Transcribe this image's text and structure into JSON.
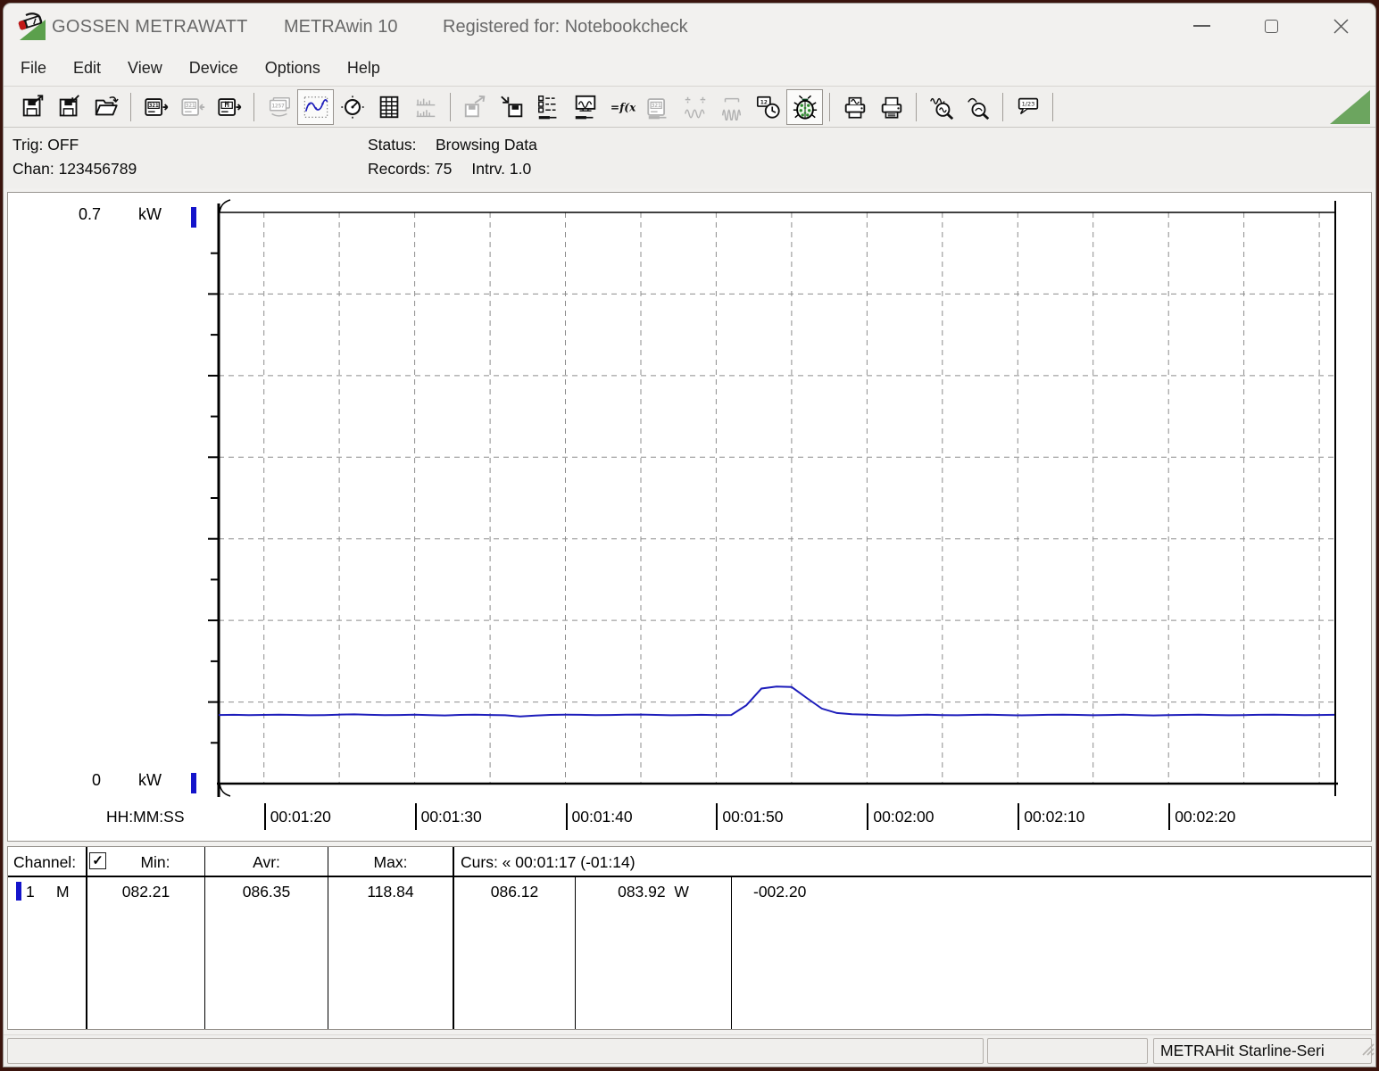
{
  "titlebar": {
    "brand": "GOSSEN METRAWATT",
    "app": "METRAwin 10",
    "registered": "Registered for: Notebookcheck"
  },
  "menu": {
    "items": [
      "File",
      "Edit",
      "View",
      "Device",
      "Options",
      "Help"
    ]
  },
  "toolbar": {
    "groups": [
      [
        {
          "name": "file-save-export",
          "state": "normal"
        },
        {
          "name": "file-save-import",
          "state": "normal"
        },
        {
          "name": "file-open",
          "state": "normal"
        }
      ],
      [
        {
          "name": "device-read",
          "state": "normal"
        },
        {
          "name": "device-send",
          "state": "disabled"
        },
        {
          "name": "memory-read",
          "state": "normal"
        }
      ],
      [
        {
          "name": "multi-display",
          "state": "disabled"
        },
        {
          "name": "line-chart-view",
          "state": "active"
        },
        {
          "name": "analog-view",
          "state": "normal"
        },
        {
          "name": "table-view",
          "state": "normal"
        },
        {
          "name": "histogram-view",
          "state": "disabled"
        }
      ],
      [
        {
          "name": "data-export",
          "state": "disabled"
        },
        {
          "name": "data-import",
          "state": "normal"
        },
        {
          "name": "channel-config",
          "state": "normal"
        },
        {
          "name": "monitor-config",
          "state": "normal"
        },
        {
          "name": "formula",
          "state": "normal"
        },
        {
          "name": "device-config",
          "state": "disabled"
        },
        {
          "name": "trigger-wave",
          "state": "disabled"
        },
        {
          "name": "envelope-wave",
          "state": "disabled"
        },
        {
          "name": "clock-device",
          "state": "normal"
        },
        {
          "name": "debug-bug",
          "state": "active"
        }
      ],
      [
        {
          "name": "print-preview",
          "state": "normal"
        },
        {
          "name": "print",
          "state": "normal"
        }
      ],
      [
        {
          "name": "zoom-in",
          "state": "normal"
        },
        {
          "name": "zoom-out",
          "state": "normal"
        }
      ],
      [
        {
          "name": "annotation",
          "state": "normal"
        }
      ]
    ],
    "corner_triangle_color": "#6ca55f"
  },
  "status_panel": {
    "trig_label": "Trig:",
    "trig_value": "OFF",
    "chan_label": "Chan:",
    "chan_value": "123456789",
    "status_label": "Status:",
    "status_value": "Browsing Data",
    "records_label": "Records:",
    "records_value": "75",
    "interval_label": "Intrv.",
    "interval_value": "1.0"
  },
  "chart_data": {
    "type": "line",
    "title": "",
    "y_axis": {
      "max_label": "0.7",
      "min_label": "0",
      "unit": "kW",
      "ylim": [
        0,
        0.7
      ],
      "divisions": 7,
      "grid": true
    },
    "x_axis": {
      "label": "HH:MM:SS",
      "start": "00:01:17",
      "end": "00:02:31",
      "interval_s": 1.0,
      "span_s": 74,
      "ticks": [
        "00:01:20",
        "00:01:30",
        "00:01:40",
        "00:01:50",
        "00:02:00",
        "00:02:10",
        "00:02:20"
      ],
      "tick_step_s": 10,
      "grid_step_s": 5,
      "first_tick_offset_s": 3
    },
    "series": [
      {
        "name": "Channel 1",
        "unit": "W",
        "color": "#1d1dbb",
        "values": [
          84.1,
          84.3,
          83.9,
          84.2,
          84.6,
          84.2,
          83.8,
          84.0,
          84.5,
          84.9,
          84.3,
          83.9,
          84.1,
          84.4,
          84.0,
          83.6,
          84.2,
          84.5,
          84.1,
          83.8,
          82.21,
          83.5,
          84.2,
          84.6,
          84.3,
          83.9,
          84.1,
          84.4,
          84.7,
          84.2,
          83.8,
          84.0,
          84.3,
          83.9,
          84.1,
          96.0,
          116.5,
          118.84,
          118.4,
          105.0,
          92.0,
          86.5,
          85.0,
          84.4,
          84.0,
          83.7,
          84.1,
          84.4,
          84.0,
          83.8,
          84.2,
          84.5,
          84.1,
          83.7,
          84.0,
          84.3,
          84.6,
          84.2,
          83.8,
          84.1,
          84.4,
          84.0,
          83.6,
          83.9,
          84.2,
          84.5,
          84.1,
          83.8,
          84.0,
          84.3,
          84.6,
          84.2,
          83.9,
          84.1,
          84.3
        ]
      }
    ],
    "stats": {
      "min": 82.21,
      "avg": 86.35,
      "max": 118.84
    },
    "cursors": {
      "left_time": "00:01:17",
      "right_time": "00:02:31",
      "delta": "-01:14"
    },
    "legend": false,
    "marker_color": "#1414cb"
  },
  "table": {
    "channel_header": "Channel:",
    "checkbox_checked": true,
    "min_header": "Min:",
    "avr_header": "Avr:",
    "max_header": "Max:",
    "curs_header": "Curs: « 00:01:17 (-01:14)",
    "row": {
      "channel": "1",
      "mode": "M",
      "min": "082.21",
      "avr": "086.35",
      "max": "118.84",
      "curs_a": "086.12",
      "curs_b": "083.92",
      "curs_b_unit": "W",
      "delta": "-002.20",
      "marker_color": "#1414cb"
    }
  },
  "statusbar": {
    "device": "METRAHit Starline-Seri"
  }
}
